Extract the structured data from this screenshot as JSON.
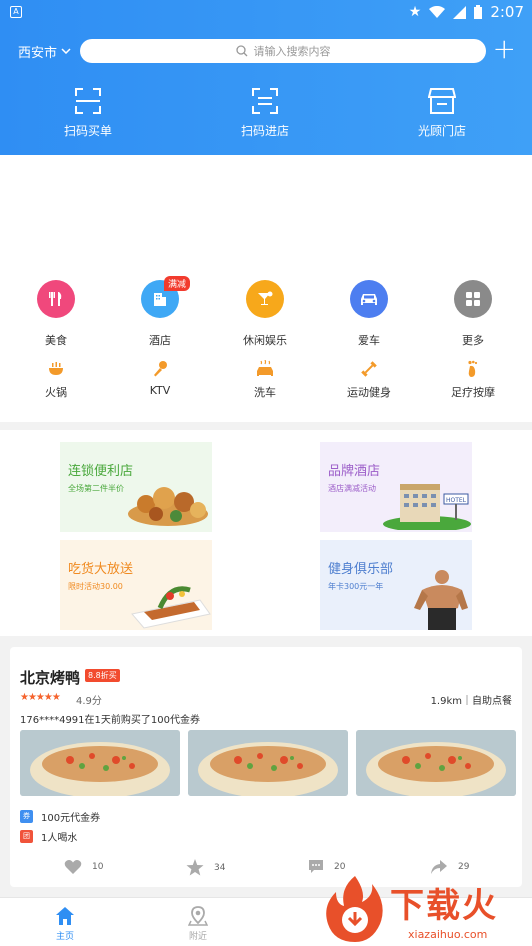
{
  "status_bar": {
    "time": "2:07",
    "left_icon": "A"
  },
  "top_bar": {
    "city": "西安市",
    "search_placeholder": "请输入搜索内容"
  },
  "quick_actions": [
    {
      "label": "扫码买单",
      "icon": "scan-icon"
    },
    {
      "label": "扫码进店",
      "icon": "scan-store-icon"
    },
    {
      "label": "光顾门店",
      "icon": "store-icon"
    }
  ],
  "categories": [
    {
      "label": "美食",
      "icon": "utensils-icon",
      "color": "#f0487c"
    },
    {
      "label": "酒店",
      "icon": "building-icon",
      "color": "#3fa8f5",
      "badge": "满减"
    },
    {
      "label": "休闲娱乐",
      "icon": "cocktail-icon",
      "color": "#f7a81b"
    },
    {
      "label": "爱车",
      "icon": "car-icon",
      "color": "#4d7ef0"
    },
    {
      "label": "更多",
      "icon": "grid-icon",
      "color": "#8a8a8a"
    }
  ],
  "subcategories": [
    {
      "label": "火锅",
      "icon": "hotpot-icon"
    },
    {
      "label": "KTV",
      "icon": "microphone-icon"
    },
    {
      "label": "洗车",
      "icon": "car-wash-icon"
    },
    {
      "label": "运动健身",
      "icon": "dumbbell-icon"
    },
    {
      "label": "足疗按摩",
      "icon": "foot-icon"
    }
  ],
  "promos": [
    {
      "title": "连锁便利店",
      "subtitle": "全场第二件半价",
      "title_color": "#4aa83c",
      "bg": "#eef8ec"
    },
    {
      "title": "品牌酒店",
      "subtitle": "酒店满减活动",
      "title_color": "#9c5ec9",
      "bg": "#f3eefb"
    },
    {
      "title": "吃货大放送",
      "subtitle": "限时活动30.00",
      "title_color": "#f08a20",
      "bg": "#fdf4e6"
    },
    {
      "title": "健身俱乐部",
      "subtitle": "年卡300元一年",
      "title_color": "#4f7fcf",
      "bg": "#eaf0fb"
    }
  ],
  "shop": {
    "name": "北京烤鸭",
    "discount_tag": "8.8折买",
    "rating": 4.9,
    "rating_text": "4.9分",
    "distance_info": "1.9km｜自助点餐",
    "purchase_notice": "176****4991在1天前购买了100代金券",
    "deals": [
      {
        "icon_text": "券",
        "text": "100元代金券",
        "color": "#3f8ff0"
      },
      {
        "icon_text": "团",
        "text": "1人喝水",
        "color": "#f0533a"
      }
    ],
    "actions": [
      {
        "icon": "heart-icon",
        "count": "10"
      },
      {
        "icon": "star-icon",
        "count": "34"
      },
      {
        "icon": "comment-icon",
        "count": "20"
      },
      {
        "icon": "share-icon",
        "count": "29"
      }
    ]
  },
  "bottom_nav": [
    {
      "label": "主页",
      "icon": "home-icon",
      "active": true
    },
    {
      "label": "附近",
      "icon": "location-icon",
      "active": false
    }
  ],
  "watermark": {
    "text": "下载火",
    "sub": "xiazaihuo.com"
  }
}
